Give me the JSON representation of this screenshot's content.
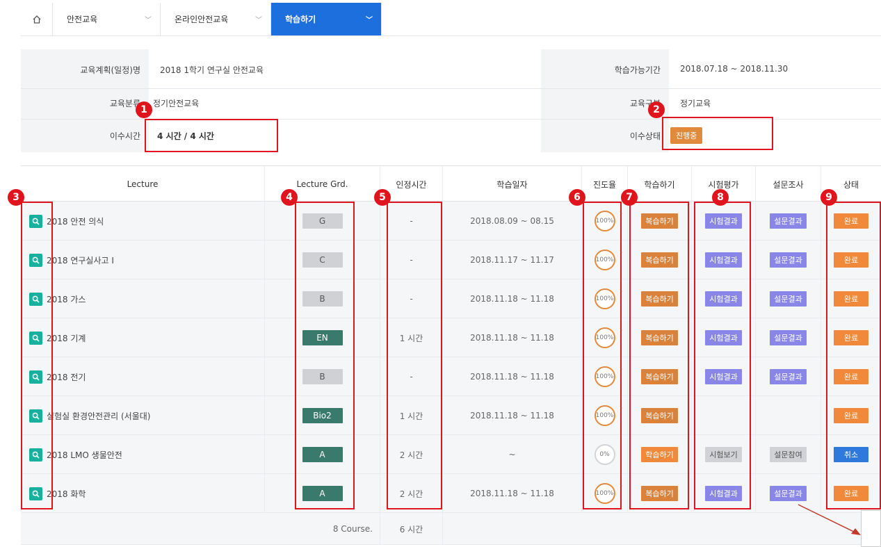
{
  "nav": {
    "items": [
      "안전교육",
      "온라인안전교육",
      "학습하기"
    ],
    "active_index": 2
  },
  "info": {
    "plan_label": "교육계획(일정)명",
    "plan_value": "2018 1학기 연구실 안전교육",
    "period_label": "학습가능기간",
    "period_value": "2018.07.18 ~ 2018.11.30",
    "category_label": "교육분류",
    "category_value": "정기안전교육",
    "type_label": "교육구분",
    "type_value": "정기교육",
    "hours_label": "이수시간",
    "hours_value": "4 시간  /  4 시간",
    "status_label": "이수상태",
    "status_value": "진행중"
  },
  "table": {
    "headers": [
      "Lecture",
      "Lecture Grd.",
      "인정시간",
      "학습일자",
      "진도율",
      "학습하기",
      "시험평가",
      "설문조사",
      "상태"
    ],
    "rows": [
      {
        "lecture": "2018 안전 의식",
        "grade": "G",
        "grade_style": "gray",
        "hours": "-",
        "date": "2018.08.09 ~ 08.15",
        "progress": "100%",
        "progress_value": 100,
        "study": "복습하기",
        "study_style": "orange",
        "exam": "시험결과",
        "exam_style": "purple",
        "survey": "설문결과",
        "survey_style": "purple",
        "status": "완료",
        "status_style": "done"
      },
      {
        "lecture": "2018 연구실사고 I",
        "grade": "C",
        "grade_style": "gray",
        "hours": "-",
        "date": "2018.11.17 ~ 11.17",
        "progress": "100%",
        "progress_value": 100,
        "study": "복습하기",
        "study_style": "orange",
        "exam": "시험결과",
        "exam_style": "purple",
        "survey": "설문결과",
        "survey_style": "purple",
        "status": "완료",
        "status_style": "done"
      },
      {
        "lecture": "2018 가스",
        "grade": "B",
        "grade_style": "gray",
        "hours": "-",
        "date": "2018.11.18 ~ 11.18",
        "progress": "100%",
        "progress_value": 100,
        "study": "복습하기",
        "study_style": "orange",
        "exam": "시험결과",
        "exam_style": "purple",
        "survey": "설문결과",
        "survey_style": "purple",
        "status": "완료",
        "status_style": "done"
      },
      {
        "lecture": "2018 기계",
        "grade": "EN",
        "grade_style": "green",
        "hours": "1 시간",
        "date": "2018.11.18 ~ 11.18",
        "progress": "100%",
        "progress_value": 100,
        "study": "복습하기",
        "study_style": "orange",
        "exam": "시험결과",
        "exam_style": "purple",
        "survey": "설문결과",
        "survey_style": "purple",
        "status": "완료",
        "status_style": "done"
      },
      {
        "lecture": "2018 전기",
        "grade": "B",
        "grade_style": "gray",
        "hours": "-",
        "date": "2018.11.18 ~ 11.18",
        "progress": "100%",
        "progress_value": 100,
        "study": "복습하기",
        "study_style": "orange",
        "exam": "시험결과",
        "exam_style": "purple",
        "survey": "설문결과",
        "survey_style": "purple",
        "status": "완료",
        "status_style": "done"
      },
      {
        "lecture": "실험실 환경안전관리 (서울대)",
        "grade": "Bio2",
        "grade_style": "green",
        "hours": "1 시간",
        "date": "2018.11.18 ~ 11.18",
        "progress": "100%",
        "progress_value": 100,
        "study": "복습하기",
        "study_style": "orange",
        "exam": "",
        "exam_style": "",
        "survey": "",
        "survey_style": "",
        "status": "완료",
        "status_style": "done"
      },
      {
        "lecture": "2018 LMO 생물안전",
        "grade": "A",
        "grade_style": "green",
        "hours": "2 시간",
        "date": "~",
        "progress": "0%",
        "progress_value": 0,
        "study": "학습하기",
        "study_style": "orange2",
        "exam": "시험보기",
        "exam_style": "gray",
        "survey": "설문참여",
        "survey_style": "gray",
        "status": "취소",
        "status_style": "blue"
      },
      {
        "lecture": "2018 화학",
        "grade": "A",
        "grade_style": "green",
        "hours": "2 시간",
        "date": "2018.11.18 ~ 11.18",
        "progress": "100%",
        "progress_value": 100,
        "study": "복습하기",
        "study_style": "orange",
        "exam": "시험결과",
        "exam_style": "purple",
        "survey": "설문결과",
        "survey_style": "purple",
        "status": "완료",
        "status_style": "done"
      }
    ],
    "footer_count": "8 Course.",
    "footer_hours": "6 시간"
  },
  "annotations": [
    "1",
    "2",
    "3",
    "4",
    "5",
    "6",
    "7",
    "8",
    "9"
  ],
  "colors": {
    "nav_active": "#1e6fde",
    "annotation_red": "#e0141c",
    "orange": "#d9823c",
    "purple": "#8a86e8",
    "teal": "#16b09d",
    "grade_green": "#3a7a6d",
    "cancel_blue": "#2f79dc"
  },
  "icons": [
    "home-icon",
    "chevron-down-icon",
    "search-icon",
    "arrow-icon"
  ]
}
